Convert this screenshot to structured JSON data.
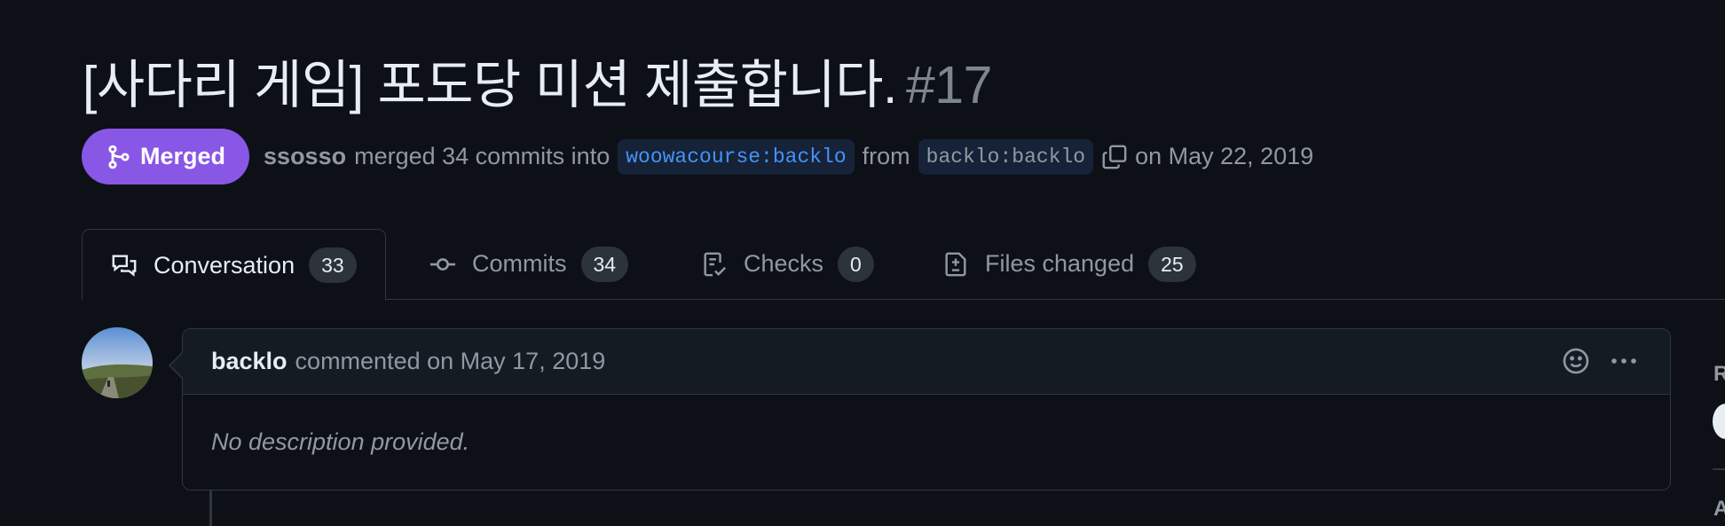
{
  "pull_request": {
    "title": "[사다리 게임] 포도당 미션 제출합니다.",
    "number": "#17",
    "state": "Merged",
    "merged_by": "ssosso",
    "merged_text": "merged 34 commits into",
    "base_branch": "woowacourse:backlo",
    "from_text": "from",
    "head_branch": "backlo:backlo",
    "date_text": "on May 22, 2019"
  },
  "tabs": [
    {
      "label": "Conversation",
      "count": "33",
      "icon": "comment-discussion-icon",
      "active": true
    },
    {
      "label": "Commits",
      "count": "34",
      "icon": "git-commit-icon",
      "active": false
    },
    {
      "label": "Checks",
      "count": "0",
      "icon": "checklist-icon",
      "active": false
    },
    {
      "label": "Files changed",
      "count": "25",
      "icon": "file-diff-icon",
      "active": false
    }
  ],
  "comment": {
    "author": "backlo",
    "meta": "commented on May 17, 2019",
    "body": "No description provided."
  },
  "sidebar": {
    "label1": "R",
    "label2": "A"
  },
  "colors": {
    "merged_badge": "#8957e5",
    "base_branch_text": "#4493f8",
    "background": "#0d1117"
  }
}
